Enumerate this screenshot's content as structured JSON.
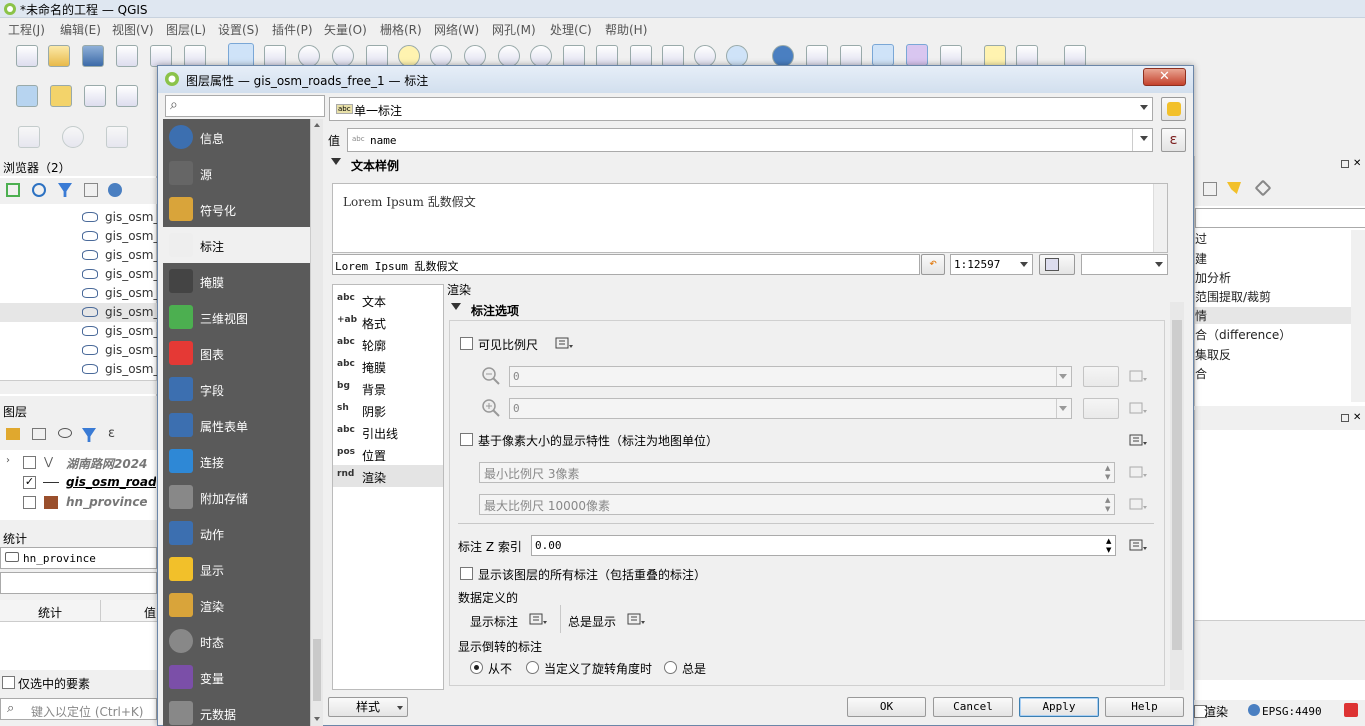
{
  "window": {
    "title": "*未命名的工程 — QGIS"
  },
  "menu": [
    "工程(J)",
    "编辑(E)",
    "视图(V)",
    "图层(L)",
    "设置(S)",
    "插件(P)",
    "矢量(O)",
    "栅格(R)",
    "网络(W)",
    "网孔(M)",
    "处理(C)",
    "帮助(H)"
  ],
  "browser": {
    "title": "浏览器（2）",
    "items": [
      "gis_osm_",
      "gis_osm_",
      "gis_osm_",
      "gis_osm_",
      "gis_osm_",
      "gis_osm_",
      "gis_osm_",
      "gis_osm_",
      "gis_osm_"
    ]
  },
  "layers": {
    "title": "图层",
    "items": [
      {
        "name": "湖南路网2024",
        "checked": false
      },
      {
        "name": "gis_osm_road",
        "checked": true
      },
      {
        "name": "hn_province",
        "checked": false
      }
    ]
  },
  "stats": {
    "title": "统计",
    "layer": "hn_province",
    "col1": "统计",
    "col2": "值",
    "selected_only": "仅选中的要素"
  },
  "locator": {
    "placeholder": "键入以定位 (Ctrl+K)"
  },
  "right_panel": {
    "items": [
      "过",
      "建",
      "加分析",
      "范围提取/裁剪",
      "情",
      "合（difference）",
      "集取反",
      "合"
    ]
  },
  "statusbar": {
    "render_label": "渲染",
    "crs": "EPSG:4490"
  },
  "dialog": {
    "title": "图层属性 — gis_osm_roads_free_1 — 标注",
    "nav": [
      {
        "label": "信息",
        "icon": "info-icon"
      },
      {
        "label": "源",
        "icon": "source-icon"
      },
      {
        "label": "符号化",
        "icon": "symbology-icon"
      },
      {
        "label": "标注",
        "icon": "labels-icon"
      },
      {
        "label": "掩膜",
        "icon": "mask-icon"
      },
      {
        "label": "三维视图",
        "icon": "3d-view-icon"
      },
      {
        "label": "图表",
        "icon": "diagram-icon"
      },
      {
        "label": "字段",
        "icon": "fields-icon"
      },
      {
        "label": "属性表单",
        "icon": "attributes-form-icon"
      },
      {
        "label": "连接",
        "icon": "joins-icon"
      },
      {
        "label": "附加存储",
        "icon": "auxiliary-storage-icon"
      },
      {
        "label": "动作",
        "icon": "actions-icon"
      },
      {
        "label": "显示",
        "icon": "display-icon"
      },
      {
        "label": "渲染",
        "icon": "rendering-icon"
      },
      {
        "label": "时态",
        "icon": "temporal-icon"
      },
      {
        "label": "变量",
        "icon": "variables-icon"
      },
      {
        "label": "元数据",
        "icon": "metadata-icon"
      }
    ],
    "label_mode": "单一标注",
    "value_label": "值",
    "value_field": "name",
    "value_field_prefix": "abc",
    "text_sample_header": "文本样例",
    "sample_text": "Lorem Ipsum 乱数假文",
    "sample_input": "Lorem Ipsum 乱数假文",
    "scale": "1:12597",
    "subtabs": [
      {
        "label": "文本",
        "icon": "abc"
      },
      {
        "label": "格式",
        "icon": "+ab"
      },
      {
        "label": "轮廓",
        "icon": "abc"
      },
      {
        "label": "掩膜",
        "icon": "abc"
      },
      {
        "label": "背景",
        "icon": "bg"
      },
      {
        "label": "阴影",
        "icon": "sh"
      },
      {
        "label": "引出线",
        "icon": "abc"
      },
      {
        "label": "位置",
        "icon": "pos"
      },
      {
        "label": "渲染",
        "icon": "rnd"
      }
    ],
    "section_title": "渲染",
    "group_title": "标注选项",
    "scale_visibility": "可见比例尺",
    "min_scale_value": "0",
    "max_scale_value": "0",
    "pixel_size": "基于像素大小的显示特性（标注为地图单位）",
    "min_pixel": "最小比例尺 3像素",
    "max_pixel": "最大比例尺 10000像素",
    "z_index_label": "标注 Z 索引",
    "z_index_value": "0.00",
    "show_all": "显示该图层的所有标注（包括重叠的标注）",
    "data_defined": "数据定义的",
    "show_label": "显示标注",
    "always_show": "总是显示",
    "upside_down": "显示倒转的标注",
    "radio_never": "从不",
    "radio_when_rotation": "当定义了旋转角度时",
    "radio_always": "总是",
    "style_button": "样式",
    "ok": "OK",
    "cancel": "Cancel",
    "apply": "Apply",
    "help": "Help"
  }
}
